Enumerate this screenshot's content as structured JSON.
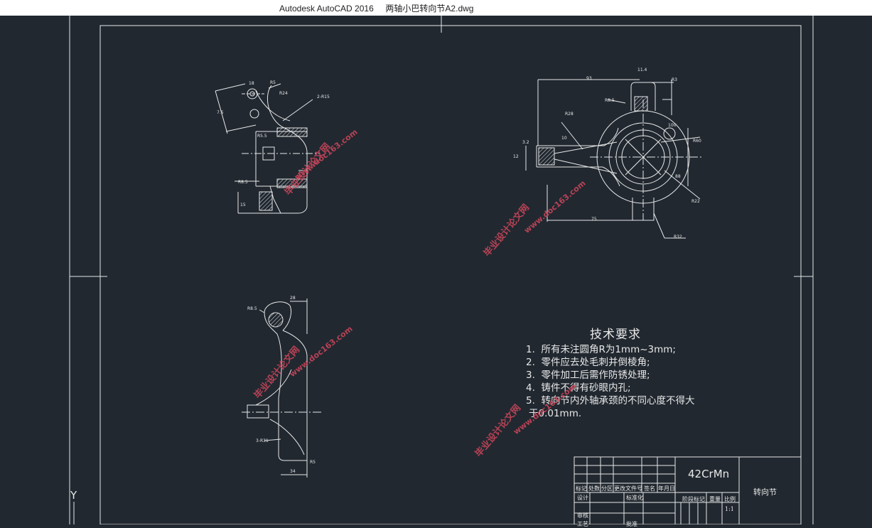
{
  "window": {
    "title": "Autodesk AutoCAD 2016     两轴小巴转向节A2.dwg"
  },
  "colors": {
    "background": "#212830",
    "lines": "#e8e8e8",
    "watermark": "#c9455a"
  },
  "ucs_icon": "Y",
  "tech_requirements": {
    "heading": "技术要求",
    "lines": [
      "1.  所有未注圆角R为1mm~3mm;",
      "2.  零件应去处毛刺并倒棱角;",
      "3.  零件加工后需作防锈处理;",
      "4.  铸件不得有砂眼内孔;",
      "5.  转向节内外轴承颈的不同心度不得大",
      "于0.01mm."
    ]
  },
  "title_block": {
    "material": "42CrMn",
    "part_name": "转向节",
    "headers": [
      "标记",
      "处数",
      "分区",
      "更改文件号",
      "签名",
      "年月日"
    ],
    "stage_label": "阶段标记",
    "weight_label": "重量",
    "scale_label": "比例",
    "scale_value": "1:1",
    "designer_label": "设计",
    "standard_label": "标准化",
    "review_label": "审核",
    "process_label": "工艺",
    "approve_label": "批准"
  },
  "watermarks": {
    "cn": "毕业设计论文网",
    "url": "www.doc163.com"
  },
  "dims": {
    "top_left": [
      "R5",
      "R24",
      "2-R15",
      "R5.5",
      "R8.5",
      "7.5",
      "18",
      "15"
    ],
    "top_right": [
      "11.4",
      "R3",
      "R28",
      "R8.5",
      "R60",
      "R22",
      "R32",
      "75",
      "93",
      "12",
      "3.2",
      "100",
      "10",
      "88"
    ],
    "bottom_left": [
      "R8.5",
      "28",
      "34",
      "3-R31",
      "R5"
    ]
  }
}
